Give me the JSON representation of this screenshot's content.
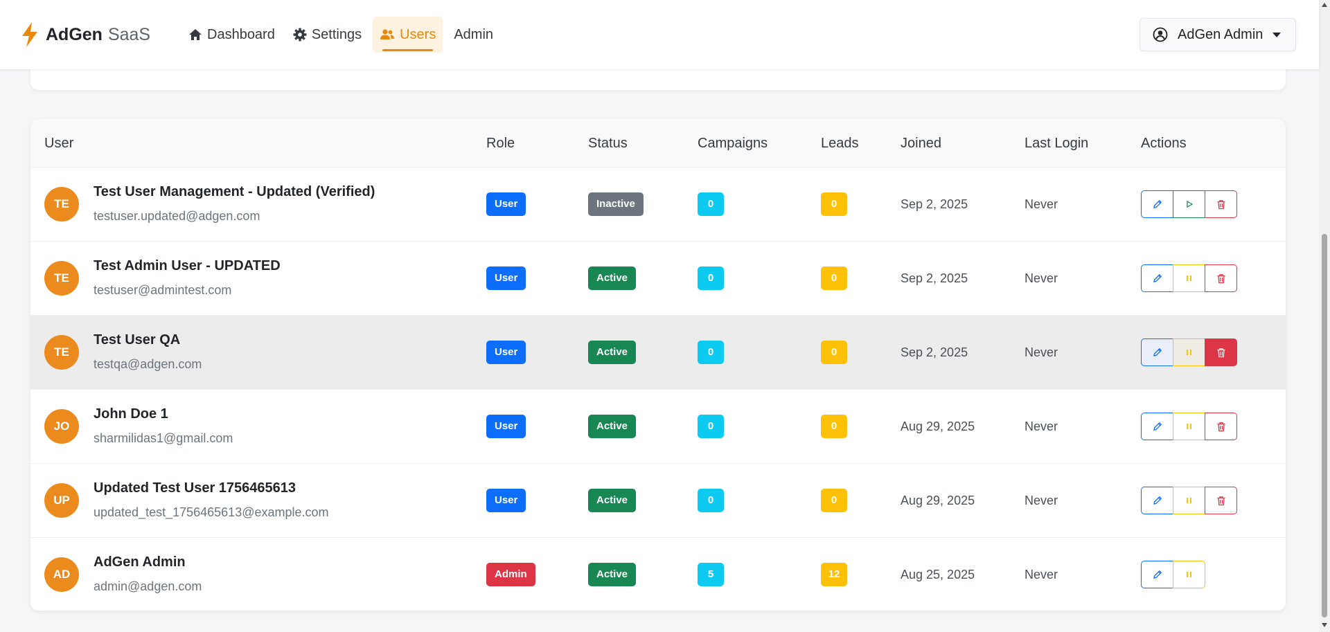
{
  "brand": {
    "name": "AdGen",
    "suffix": "SaaS",
    "accent": "#e8890d"
  },
  "nav": [
    {
      "label": "Dashboard",
      "icon": "house-icon"
    },
    {
      "label": "Settings",
      "icon": "gear-icon"
    },
    {
      "label": "Users",
      "icon": "users-icon",
      "active": true
    },
    {
      "label": "Admin",
      "icon": ""
    }
  ],
  "user_menu": {
    "label": "AdGen Admin",
    "icon": "user-circle-icon"
  },
  "table": {
    "headers": [
      "User",
      "Role",
      "Status",
      "Campaigns",
      "Leads",
      "Joined",
      "Last Login",
      "Actions"
    ],
    "rows": [
      {
        "initials": "TE",
        "name": "Test User Management - Updated (Verified)",
        "email": "testuser.updated@adgen.com",
        "role": "User",
        "status": "Inactive",
        "campaigns": "0",
        "leads": "0",
        "joined": "Sep 2, 2025",
        "last_login": "Never"
      },
      {
        "initials": "TE",
        "name": "Test Admin User - UPDATED",
        "email": "testuser@admintest.com",
        "role": "User",
        "status": "Active",
        "campaigns": "0",
        "leads": "0",
        "joined": "Sep 2, 2025",
        "last_login": "Never"
      },
      {
        "initials": "TE",
        "name": "Test User QA",
        "email": "testqa@adgen.com",
        "role": "User",
        "status": "Active",
        "campaigns": "0",
        "leads": "0",
        "joined": "Sep 2, 2025",
        "last_login": "Never"
      },
      {
        "initials": "JO",
        "name": "John Doe 1",
        "email": "sharmilidas1@gmail.com",
        "role": "User",
        "status": "Active",
        "campaigns": "0",
        "leads": "0",
        "joined": "Aug 29, 2025",
        "last_login": "Never"
      },
      {
        "initials": "UP",
        "name": "Updated Test User 1756465613",
        "email": "updated_test_1756465613@example.com",
        "role": "User",
        "status": "Active",
        "campaigns": "0",
        "leads": "0",
        "joined": "Aug 29, 2025",
        "last_login": "Never"
      },
      {
        "initials": "AD",
        "name": "AdGen Admin",
        "email": "admin@adgen.com",
        "role": "Admin",
        "status": "Active",
        "campaigns": "5",
        "leads": "12",
        "joined": "Aug 25, 2025",
        "last_login": "Never"
      }
    ]
  }
}
